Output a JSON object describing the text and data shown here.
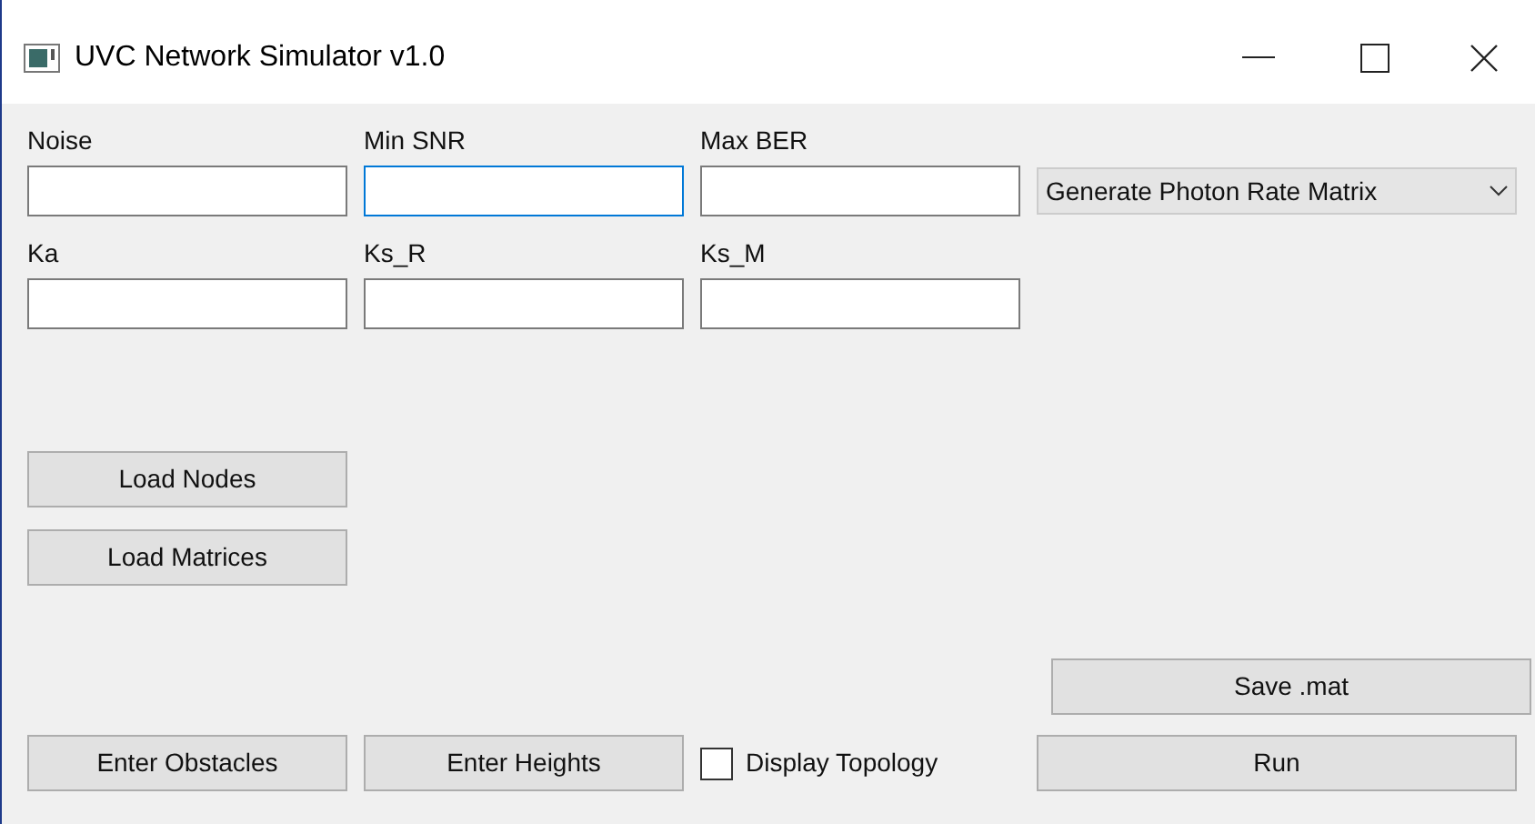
{
  "window": {
    "title": "UVC Network Simulator v1.0"
  },
  "fields": [
    {
      "label": "Noise",
      "focused": false
    },
    {
      "label": "Min SNR",
      "focused": true
    },
    {
      "label": "Max BER",
      "focused": false
    },
    {
      "label": "Ka",
      "focused": false
    },
    {
      "label": "Ks_R",
      "focused": false
    },
    {
      "label": "Ks_M",
      "focused": false
    }
  ],
  "mode_dropdown": {
    "value": "Generate Photon Rate Matrix"
  },
  "load_buttons": [
    "Load Nodes",
    "Load Matrices"
  ],
  "save_button": "Save .mat",
  "bottom_buttons": [
    "Enter Obstacles",
    "Enter Heights"
  ],
  "display_topology": {
    "label": "Display Topology",
    "checked": false
  },
  "run_button": "Run"
}
